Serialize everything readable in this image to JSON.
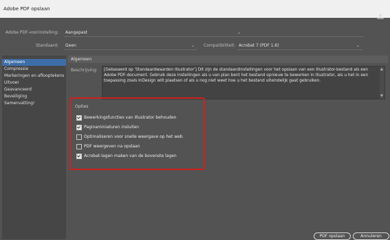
{
  "window": {
    "title": "Adobe PDF opslaan"
  },
  "preset": {
    "label": "Adobe PDF-voorinstelling:",
    "value": "Aangepast"
  },
  "standard": {
    "label": "Standaard:",
    "value": "Geen"
  },
  "compat": {
    "label": "Compatibiliteit:",
    "value": "Acrobat 7 (PDF 1.6)"
  },
  "icons": {
    "save_preset": "save-preset-icon",
    "dropdown": "chevron-down-icon"
  },
  "sidebar": {
    "items": [
      {
        "label": "Algemeen",
        "active": true
      },
      {
        "label": "Compressie"
      },
      {
        "label": "Markeringen en aflooptekens"
      },
      {
        "label": "Uitvoer"
      },
      {
        "label": "Geavanceerd"
      },
      {
        "label": "Beveiliging"
      },
      {
        "label": "Samenvatting!"
      }
    ]
  },
  "main": {
    "section_title": "Algemeen",
    "description_label": "Beschrijving:",
    "description_text": "[Gebaseerd op 'Standaardwaarden Illustrator'] Dit zijn de standaardinstellingen voor het opslaan van een Illustrator-bestand als een Adobe PDF-document. Gebruik deze instellingen als u van plan bent het bestand opnieuw te bewerken in Illustrator, als u het in een toepassing zoals InDesign wilt plaatsen of als u nog niet weet hoe u het bestand uiteindelijk gaat gebruiken.",
    "options": {
      "title": "Opties",
      "items": [
        {
          "label": "Bewerkingsfuncties van Illustrator behouden",
          "checked": true
        },
        {
          "label": "Paginaminiaturen insluiten",
          "checked": true
        },
        {
          "label": "Optimaliseren voor snelle weergave op het web",
          "checked": false
        },
        {
          "label": "PDF weergeven na opslaan",
          "checked": false
        },
        {
          "label": "Acrobat-lagen maken van de bovenste lagen",
          "checked": true
        }
      ]
    }
  },
  "footer": {
    "save_label": "PDF opslaan",
    "cancel_label": "Annuleren"
  },
  "colors": {
    "accent": "#3e6ea8",
    "highlight_border": "#d0201e",
    "background": "#535353"
  }
}
